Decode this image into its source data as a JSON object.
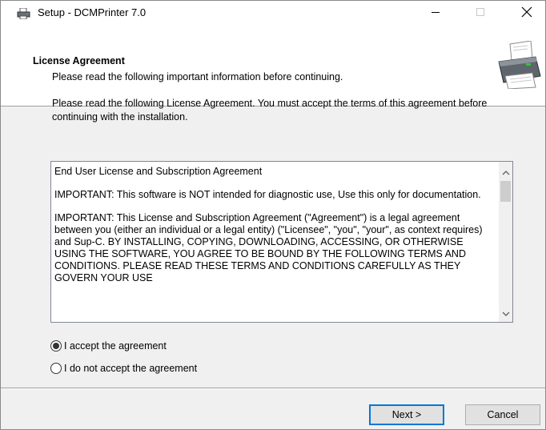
{
  "window": {
    "title": "Setup - DCMPrinter 7.0"
  },
  "header": {
    "title": "License Agreement",
    "subtitle": "Please read the following important information before continuing."
  },
  "body": {
    "intro": "Please read the following License Agreement. You must accept the terms of this agreement before continuing with the installation.",
    "license_paragraphs": [
      "End User License and Subscription Agreement",
      "IMPORTANT: This software is NOT intended for diagnostic use, Use this only for documentation.",
      "IMPORTANT: This License and Subscription Agreement (\"Agreement\") is a legal agreement between you (either an individual or a legal entity) (\"Licensee\", \"you\", \"your\", as context requires) and Sup-C. BY INSTALLING, COPYING, DOWNLOADING, ACCESSING, OR OTHERWISE USING THE SOFTWARE, YOU AGREE TO BE BOUND BY THE FOLLOWING TERMS AND CONDITIONS. PLEASE READ THESE TERMS AND CONDITIONS CAREFULLY AS THEY GOVERN YOUR USE"
    ]
  },
  "options": {
    "accept_label": "I accept the agreement",
    "decline_label": "I do not accept the agreement",
    "selected": "accept"
  },
  "buttons": {
    "next_label": "Next >",
    "cancel_label": "Cancel"
  },
  "icons": {
    "app": "printer-app-icon",
    "header_graphic": "printer-icon",
    "minimize": "minimize-icon",
    "maximize": "maximize-icon",
    "close": "close-icon"
  },
  "colors": {
    "accent": "#0078d7",
    "header_bg": "#ffffff",
    "dialog_bg": "#f0f0f0"
  }
}
